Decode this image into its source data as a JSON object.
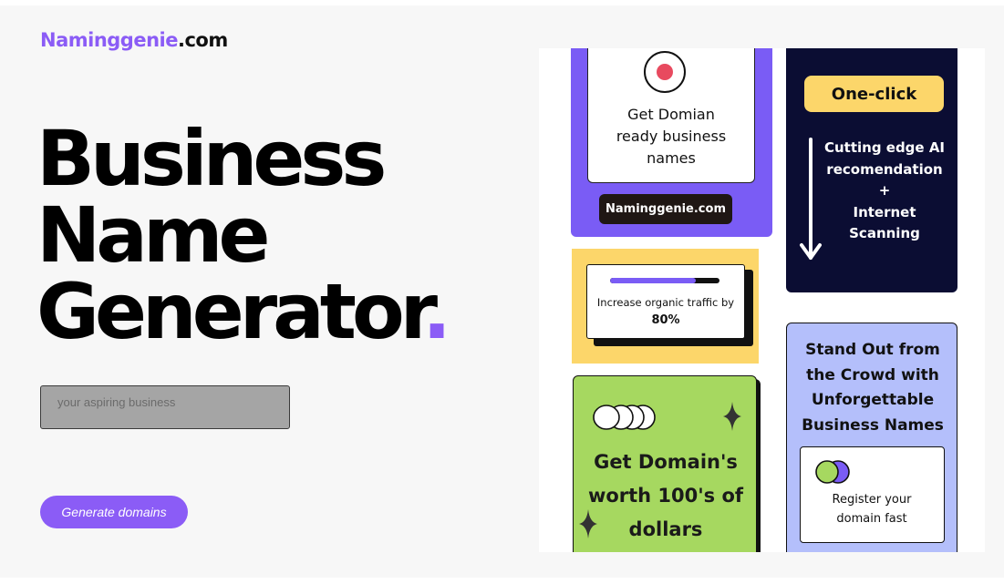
{
  "header": {
    "brand_name": "Naminggenie",
    "brand_tld": ".com"
  },
  "hero": {
    "line1": "Business",
    "line2": "Name",
    "line3": "Generator",
    "dot": "."
  },
  "search": {
    "placeholder": "your aspiring business"
  },
  "actions": {
    "generate_label": "Generate domains"
  },
  "colors": {
    "accent": "#8b5cf6",
    "navy": "#0b0d33",
    "yellow": "#fcd66a",
    "green": "#a6d860",
    "lavender": "#b4bffb",
    "record_red": "#e84a5f"
  },
  "cards": {
    "domain_ready": {
      "icon": "record-icon",
      "line1": "Get Domian",
      "line2": "ready business",
      "line3": "names",
      "pill": "Naminggenie.com"
    },
    "one_click": {
      "pill": "One-click",
      "icon": "arrow-down-icon",
      "line1": "Cutting edge AI",
      "line2": "recomendation",
      "line3": "+",
      "line4": "Internet",
      "line5": "Scanning"
    },
    "traffic": {
      "progress_percent": 78,
      "line1": "Increase organic traffic by",
      "line2": "80%"
    },
    "worth": {
      "icon_circles": "overlapping-circles-icon",
      "icon_sparkle": "sparkle-icon",
      "line1": "Get Domain's",
      "line2": "worth 100's of",
      "line3": "dollars"
    },
    "stand_out": {
      "line1": "Stand Out from",
      "line2": "the Crowd with",
      "line3": "Unforgettable",
      "line4": "Business Names",
      "icon": "overlapping-circles-icon",
      "inner_line1": "Register your",
      "inner_line2": "domain fast"
    }
  }
}
